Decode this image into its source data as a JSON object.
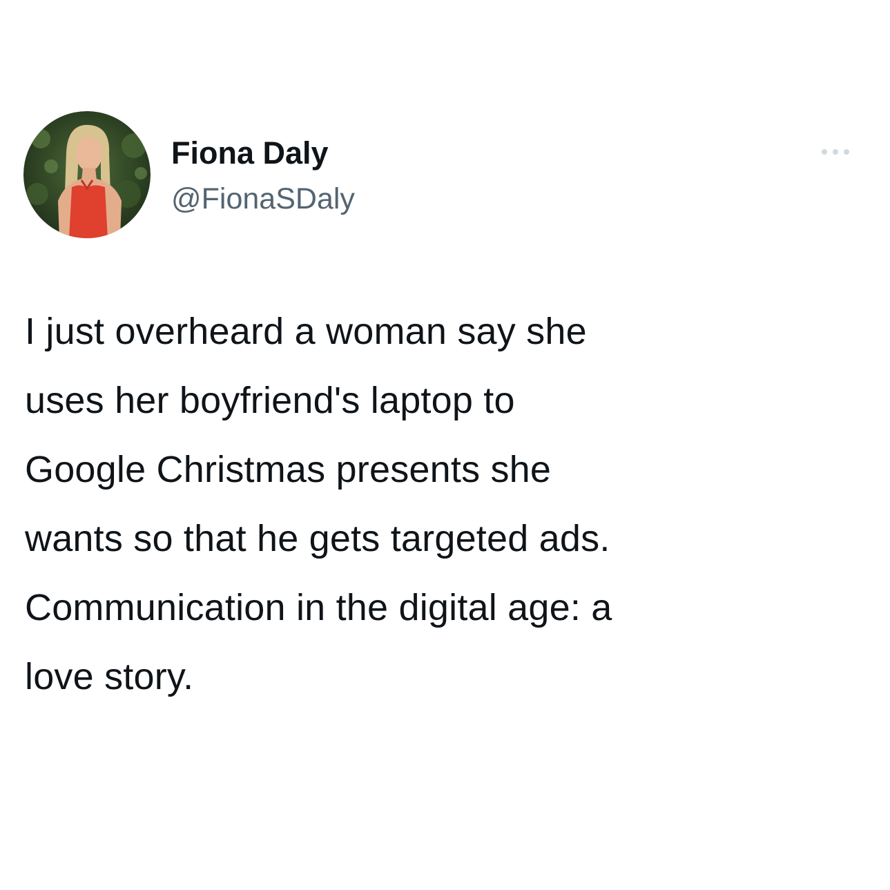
{
  "tweet": {
    "author": {
      "display_name": "Fiona Daly",
      "handle": "@FionaSDaly",
      "avatar_icon": "profile-photo"
    },
    "more_icon": "more-horizontal-icon",
    "text": "I just overheard a woman say she\nuses her boyfriend's laptop to\nGoogle Christmas presents she\nwants so that he gets targeted ads.\nCommunication in the digital age: a\nlove story."
  },
  "colors": {
    "background": "#ffffff",
    "text_primary": "#0f1419",
    "text_secondary": "#536471",
    "icon_muted": "#cfd9de"
  }
}
